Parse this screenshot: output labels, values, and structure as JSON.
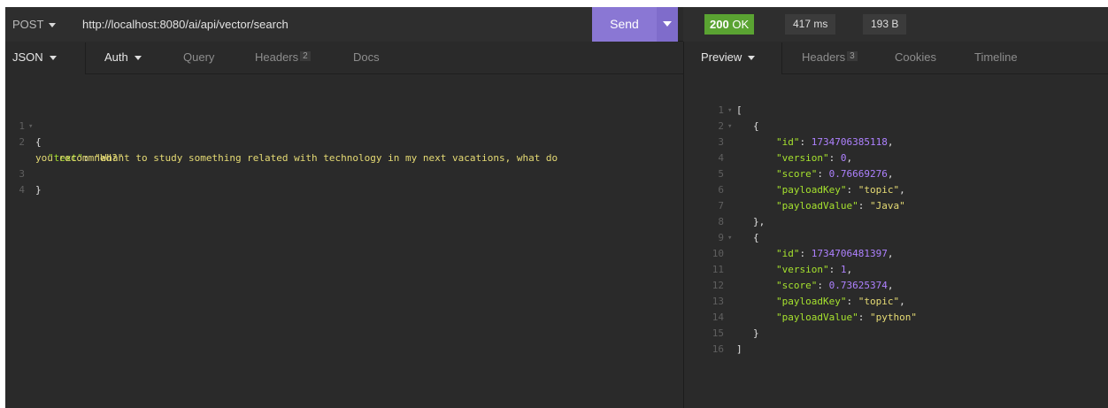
{
  "request": {
    "method": "POST",
    "url": "http://localhost:8080/ai/api/vector/search",
    "send_label": "Send"
  },
  "response": {
    "status_code": "200",
    "status_text": "OK",
    "time": "417 ms",
    "size": "193 B"
  },
  "request_tabs": {
    "body_type": "JSON",
    "auth": "Auth",
    "query": "Query",
    "headers": "Headers",
    "headers_count": "2",
    "docs": "Docs"
  },
  "response_tabs": {
    "preview": "Preview",
    "headers": "Headers",
    "headers_count": "3",
    "cookies": "Cookies",
    "timeline": "Timeline"
  },
  "request_body": {
    "line_numbers": [
      "1",
      "2",
      "",
      "3",
      "4"
    ],
    "key": "\"text\"",
    "value_part1": "\"Whant to study something related with technology in my next vacations, what do",
    "value_part2": "you recommned?\""
  },
  "response_body": {
    "line_numbers": [
      "1",
      "2",
      "3",
      "4",
      "5",
      "6",
      "7",
      "8",
      "9",
      "10",
      "11",
      "12",
      "13",
      "14",
      "15",
      "16"
    ],
    "items": [
      {
        "id_key": "\"id\"",
        "id": "1734706385118",
        "version_key": "\"version\"",
        "version": "0",
        "score_key": "\"score\"",
        "score": "0.76669276",
        "payloadKey_key": "\"payloadKey\"",
        "payloadKey": "\"topic\"",
        "payloadValue_key": "\"payloadValue\"",
        "payloadValue": "\"Java\""
      },
      {
        "id_key": "\"id\"",
        "id": "1734706481397",
        "version_key": "\"version\"",
        "version": "1",
        "score_key": "\"score\"",
        "score": "0.73625374",
        "payloadKey_key": "\"payloadKey\"",
        "payloadKey": "\"topic\"",
        "payloadValue_key": "\"payloadValue\"",
        "payloadValue": "\"python\""
      }
    ]
  },
  "colors": {
    "send": "#8a77d4",
    "status_ok": "#5aa332",
    "json_key": "#a6e22e",
    "json_string": "#e6db74",
    "json_number": "#ae81ff"
  }
}
